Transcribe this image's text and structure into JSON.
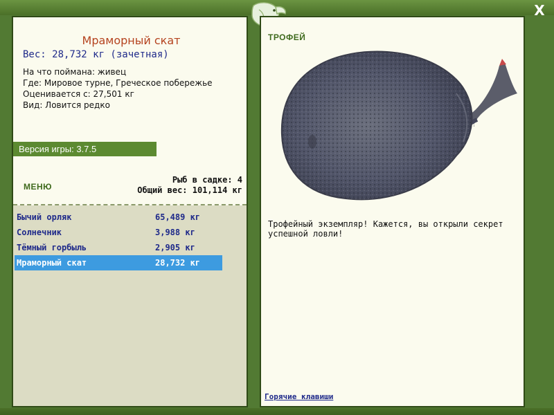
{
  "window": {
    "close_label": "X"
  },
  "fish_info": {
    "name": "Мраморный скат",
    "weight": "Вес: 28,732 кг (зачетная)",
    "bait": "На что поймана: живец",
    "location": "Где: Мировое турне, Греческое побережье",
    "rated_from": "Оценивается с: 27,501 кг",
    "rarity": "Вид: Ловится редко"
  },
  "version": "Версия игры: 3.7.5",
  "menu_label": "МЕНЮ",
  "keep_stats": {
    "count": "Рыб в садке: 4",
    "total": "Общий вес: 101,114 кг"
  },
  "fish_list": [
    {
      "name": "Бычий орляк",
      "weight": "65,489 кг"
    },
    {
      "name": "Солнечник",
      "weight": "3,988 кг"
    },
    {
      "name": "Тёмный горбыль",
      "weight": "2,905 кг"
    },
    {
      "name": "Мраморный скат",
      "weight": "28,732 кг"
    }
  ],
  "selected_index": 3,
  "trophy_label": "ТРОФЕЙ",
  "description_line1": "Трофейный экземпляр! Кажется, вы открыли секрет",
  "description_line2": "успешной ловли!",
  "hotkeys_link": "Горячие клавиши",
  "colors": {
    "frame": "#527a33",
    "panel": "#fbfbee",
    "selected_row": "#3d9be0",
    "title": "#b5431f",
    "link": "#1f2a8a"
  }
}
